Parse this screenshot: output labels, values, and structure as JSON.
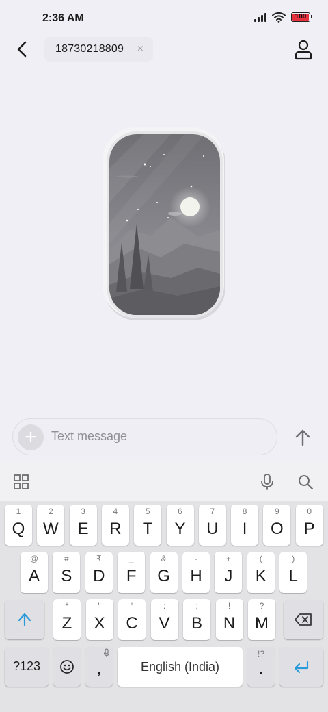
{
  "status_bar": {
    "time": "2:36 AM",
    "battery_level": "100"
  },
  "header": {
    "recipient": "18730218809",
    "remove_glyph": "×"
  },
  "compose": {
    "placeholder": "Text message",
    "attach_glyph": "+"
  },
  "keyboard": {
    "row1": [
      {
        "key": "Q",
        "hint": "1"
      },
      {
        "key": "W",
        "hint": "2"
      },
      {
        "key": "E",
        "hint": "3"
      },
      {
        "key": "R",
        "hint": "4"
      },
      {
        "key": "T",
        "hint": "5"
      },
      {
        "key": "Y",
        "hint": "6"
      },
      {
        "key": "U",
        "hint": "7"
      },
      {
        "key": "I",
        "hint": "8"
      },
      {
        "key": "O",
        "hint": "9"
      },
      {
        "key": "P",
        "hint": "0"
      }
    ],
    "row2": [
      {
        "key": "A",
        "hint": "@"
      },
      {
        "key": "S",
        "hint": "#"
      },
      {
        "key": "D",
        "hint": "₹"
      },
      {
        "key": "F",
        "hint": "_"
      },
      {
        "key": "G",
        "hint": "&"
      },
      {
        "key": "H",
        "hint": "-"
      },
      {
        "key": "J",
        "hint": "+"
      },
      {
        "key": "K",
        "hint": "("
      },
      {
        "key": "L",
        "hint": ")"
      }
    ],
    "row3": [
      {
        "key": "Z",
        "hint": "*"
      },
      {
        "key": "X",
        "hint": "\""
      },
      {
        "key": "C",
        "hint": "'"
      },
      {
        "key": "V",
        "hint": ":"
      },
      {
        "key": "B",
        "hint": ";"
      },
      {
        "key": "N",
        "hint": "!"
      },
      {
        "key": "M",
        "hint": "?"
      }
    ],
    "symbols_label": "?123",
    "comma": ",",
    "space_label": "English (India)",
    "period": ".",
    "period_hint": "!?"
  },
  "icons": {
    "back": "chevron-left-icon",
    "profile": "person-icon",
    "send": "arrow-up-icon",
    "apps": "grid-icon",
    "mic": "microphone-icon",
    "search": "search-icon",
    "shift": "shift-icon",
    "backspace": "backspace-icon",
    "enter": "enter-icon",
    "emoji": "smiley-icon"
  },
  "colors": {
    "accent": "#2a9ad8",
    "battery_red": "#e6313f",
    "background": "#f0eff5"
  }
}
